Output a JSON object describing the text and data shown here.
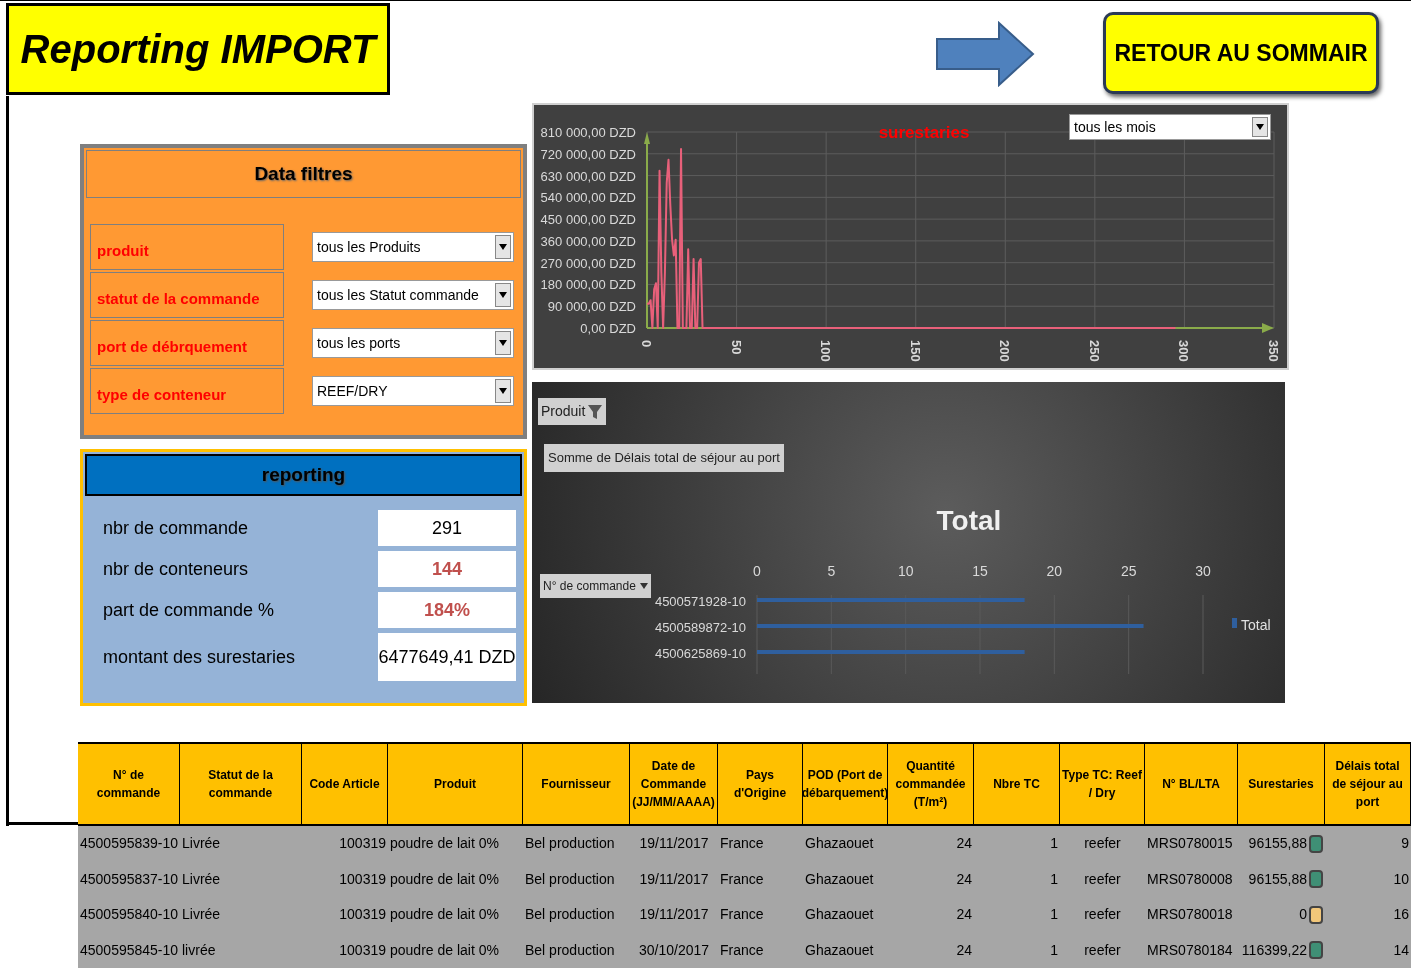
{
  "title": "Reporting IMPORT",
  "return_button": "RETOUR AU SOMMAIR",
  "filters": {
    "title": "Data filtres",
    "items": [
      {
        "label": "produit",
        "value": "tous les Produits"
      },
      {
        "label": "statut de la commande",
        "value": "tous les Statut commande"
      },
      {
        "label": "port de débrquement",
        "value": "tous les ports"
      },
      {
        "label": "type de conteneur",
        "value": "REEF/DRY"
      }
    ]
  },
  "reporting": {
    "title": "reporting",
    "items": [
      {
        "label": "nbr de commande",
        "value": "291",
        "alert": false
      },
      {
        "label": "nbr de conteneurs",
        "value": "144",
        "alert": true
      },
      {
        "label": "part de commande %",
        "value": "184%",
        "alert": true
      },
      {
        "label": "montant des surestaries",
        "value": "6477649,41  DZD",
        "alert": false
      }
    ]
  },
  "line_chart": {
    "month_filter": "tous les mois",
    "chart_data": {
      "type": "line",
      "title": "surestaries",
      "x": [
        0,
        1,
        2,
        3,
        4,
        5,
        6,
        7,
        8,
        9,
        10,
        11,
        12,
        13,
        14,
        15,
        16,
        17,
        18,
        19,
        20,
        21,
        22,
        23,
        24,
        25,
        26,
        27,
        28,
        29,
        30,
        31,
        295
      ],
      "grid": true,
      "series": [
        {
          "color": "#e8607a",
          "values": [
            100000,
            100000,
            115000,
            0,
            160000,
            185000,
            0,
            650000,
            230000,
            0,
            230000,
            600000,
            695000,
            510000,
            365000,
            300000,
            365000,
            0,
            0,
            740000,
            0,
            0,
            0,
            325000,
            0,
            0,
            285000,
            0,
            0,
            270000,
            285000,
            0,
            0
          ]
        }
      ],
      "xlim": [
        0,
        350
      ],
      "ylim": [
        0,
        810000
      ],
      "xticks": [
        0,
        50,
        100,
        150,
        200,
        250,
        300,
        350
      ],
      "yticks": [
        {
          "value": 0,
          "label": "0,00 DZD"
        },
        {
          "value": 90000,
          "label": "90 000,00 DZD"
        },
        {
          "value": 180000,
          "label": "180 000,00 DZD"
        },
        {
          "value": 270000,
          "label": "270 000,00 DZD"
        },
        {
          "value": 360000,
          "label": "360 000,00 DZD"
        },
        {
          "value": 450000,
          "label": "450 000,00 DZD"
        },
        {
          "value": 540000,
          "label": "540 000,00 DZD"
        },
        {
          "value": 630000,
          "label": "630 000,00 DZD"
        },
        {
          "value": 720000,
          "label": "720 000,00 DZD"
        },
        {
          "value": 810000,
          "label": "810 000,00 DZD"
        }
      ]
    }
  },
  "bar_chart": {
    "report_filter": "Produit",
    "value_field": "Somme  de Délais  total de séjour au port",
    "axis_field": "N° de commande",
    "chart_data": {
      "type": "bar",
      "orientation": "horizontal",
      "title": "Total",
      "categories": [
        "4500571928-10",
        "4500589872-10",
        "4500625869-10"
      ],
      "grid": true,
      "series": [
        {
          "name": "Total",
          "color": "#2f5f9e",
          "values": [
            18,
            26,
            18
          ]
        }
      ],
      "xlim": [
        0,
        30
      ],
      "xticks": [
        0,
        5,
        10,
        15,
        20,
        25,
        30
      ]
    }
  },
  "table": {
    "columns": [
      "N° de commande",
      "Statut de la commande",
      "Code Article",
      "Produit",
      "Fournisseur",
      "Date de Commande (JJ/MM/AAAA)",
      "Pays d'Origine",
      "POD (Port de débarquement)",
      "Quantité commandée (T/m²)",
      "Nbre TC",
      "Type TC: Reef / Dry",
      "N° BL/LTA",
      "Surestaries",
      "Délais total de séjour au port"
    ],
    "rows": [
      {
        "cells": [
          "4500595839-10",
          "Livrée",
          "100319",
          "poudre de lait 0%",
          "Bel production",
          "19/11/2017",
          "France",
          "Ghazaouet",
          "24",
          "1",
          "reefer",
          "MRS0780015",
          "96155,88",
          "9"
        ],
        "color": "#3f8f75"
      },
      {
        "cells": [
          "4500595837-10",
          "Livrée",
          "100319",
          "poudre de lait 0%",
          "Bel production",
          "19/11/2017",
          "France",
          "Ghazaouet",
          "24",
          "1",
          "reefer",
          "MRS0780008",
          "96155,88",
          "10"
        ],
        "color": "#3f8f75"
      },
      {
        "cells": [
          "4500595840-10",
          "Livrée",
          "100319",
          "poudre de lait 0%",
          "Bel production",
          "19/11/2017",
          "France",
          "Ghazaouet",
          "24",
          "1",
          "reefer",
          "MRS0780018",
          "0",
          "16"
        ],
        "color": "#f2c77a"
      },
      {
        "cells": [
          "4500595845-10",
          "livrée",
          "100319",
          "poudre de lait 0%",
          "Bel production",
          "30/10/2017",
          "France",
          "Ghazaouet",
          "24",
          "1",
          "reefer",
          "MRS0780184",
          "116399,22",
          "14"
        ],
        "color": "#3f8f75"
      }
    ]
  }
}
